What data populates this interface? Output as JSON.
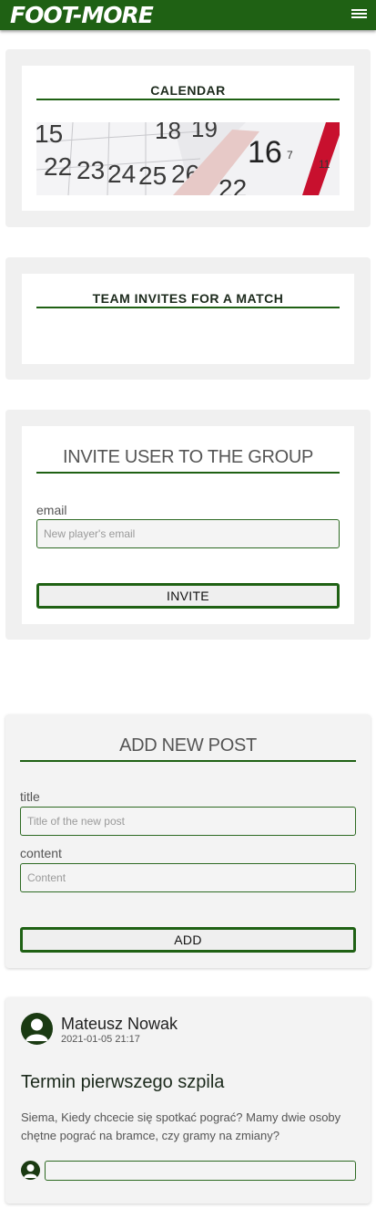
{
  "header": {
    "logo_text": "FOOT-MORE",
    "menu_icon": "hamburger-menu-icon",
    "bar_color": "#1f6114"
  },
  "calendar": {
    "title": "CALENDAR",
    "image_icon": "calendar-pages-image"
  },
  "team_invites": {
    "title": "TEAM INVITES FOR A MATCH"
  },
  "invite_user": {
    "title": "INVITE USER TO THE GROUP",
    "email_label": "email",
    "email_placeholder": "New player's email",
    "button_label": "INVITE"
  },
  "add_post": {
    "title": "ADD NEW POST",
    "title_label": "title",
    "title_placeholder": "Title of the new post",
    "content_label": "content",
    "content_placeholder": "Content",
    "button_label": "ADD"
  },
  "post": {
    "author": "Mateusz Nowak",
    "timestamp": "2021-01-05 21:17",
    "title": "Termin pierwszego szpila",
    "body": "Siema, Kiedy chcecie się spotkać pograć? Mamy dwie osoby chętne pograć na bramce, czy gramy na zmiany?",
    "comment_placeholder": ""
  },
  "colors": {
    "accent": "#1f6114",
    "panel": "#f0f0f0"
  }
}
